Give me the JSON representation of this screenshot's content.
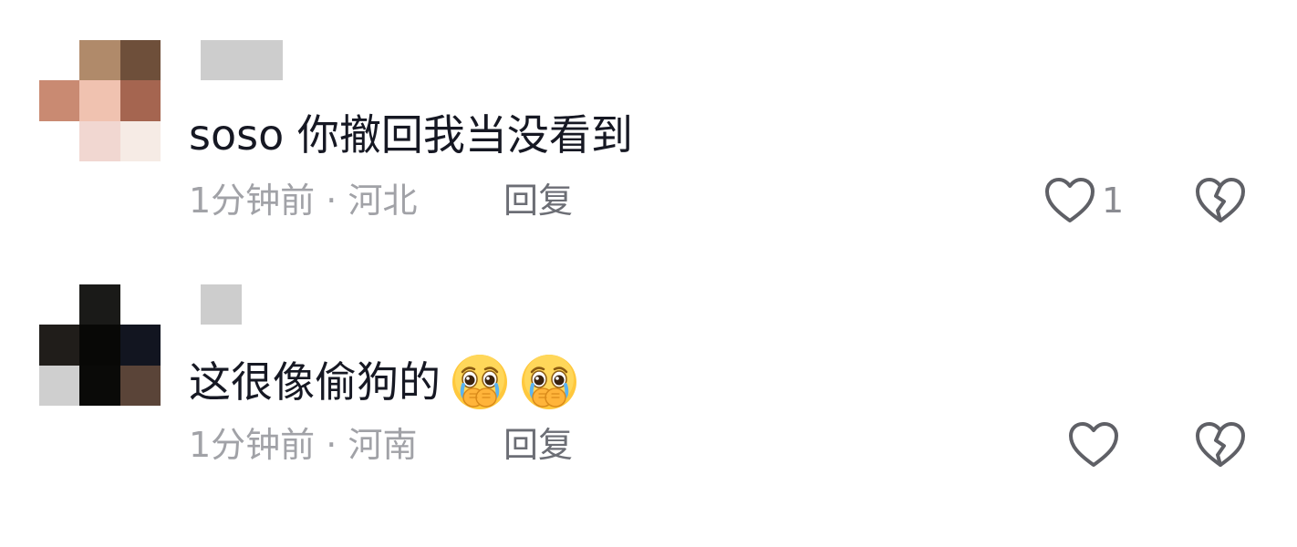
{
  "comments": [
    {
      "text": "soso 你撤回我当没看到",
      "time": "1分钟前",
      "separator": "·",
      "location": "河北",
      "reply_label": "回复",
      "like_count": "1",
      "avatar_colors": [
        "#ffffff",
        "#b08a6a",
        "#6e4f3a",
        "#c98a72",
        "#f0c2b0",
        "#a56550",
        "#ffffff",
        "#f1d7d1",
        "#f6ebe5"
      ],
      "username_redacted_color": "#cdcdcd"
    },
    {
      "text": "这很像偷狗的",
      "time": "1分钟前",
      "separator": "·",
      "location": "河南",
      "reply_label": "回复",
      "like_count": "",
      "emojis": [
        "pleading-crying-hands-over-mouth-emoji",
        "pleading-crying-hands-over-mouth-emoji"
      ],
      "avatar_colors": [
        "#ffffff",
        "#1a1a18",
        "#ffffff",
        "#201d1a",
        "#080806",
        "#121520",
        "#cfcfcf",
        "#0a0a08",
        "#5a4438"
      ],
      "username_redacted_color": "#cdcdcd"
    }
  ],
  "icons": {
    "like": "heart-outline-icon",
    "dislike": "broken-heart-icon"
  },
  "colors": {
    "text_primary": "#161823",
    "text_meta": "#a1a2a7",
    "text_reply": "#6c6e75",
    "icon_stroke": "#5f6066"
  }
}
